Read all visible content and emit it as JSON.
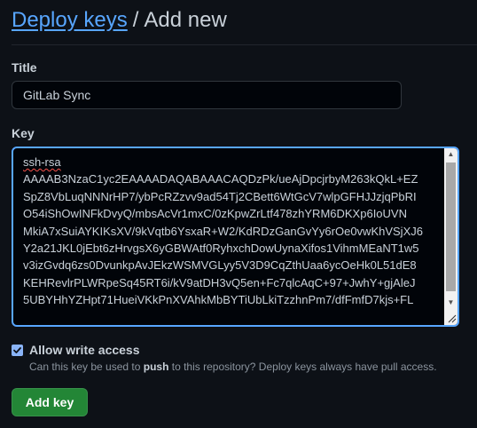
{
  "header": {
    "breadcrumb_link": "Deploy keys",
    "separator": "/",
    "current": "Add new"
  },
  "form": {
    "title_label": "Title",
    "title_value": "GitLab Sync",
    "key_label": "Key",
    "key_lines": [
      "ssh-rsa",
      "AAAAB3NzaC1yc2EAAAADAQABAAACAQDzPk/ueAjDpcjrbyM263kQkL+EZ",
      "SpZ8VbLuqNNNrHP7/ybPcRZzvv9ad54Tj2CBett6WtGcV7wlpGFHJJzjqPbRI",
      "O54iShOwINFkDvyQ/mbsAcVr1mxC/0zKpwZrLtf478zhYRM6DKXp6IoUVN",
      "MkiA7xSuiAYKIKsXV/9kVqtb6YsxaR+W2/KdRDzGanGvYy6rOe0vwKhVSjXJ6",
      "Y2a21JKL0jEbt6zHrvgsX6yGBWAtf0RyhxchDowUynaXifos1VihmMEaNT1w5",
      "v3izGvdq6zs0DvunkpAvJEkzWSMVGLyy5V3D9CqZthUaa6ycOeHk0L51dE8",
      "KEHRevlrPLWRpeSq45RT6i/kV9atDH3vQ5en+Fc7qlcAqC+97+JwhY+gjAleJ",
      "5UBYHhYZHpt71HueiVKkPnXVAhkMbBYTiUbLkiTzzhnPm7/dfFmfD7kjs+FL"
    ],
    "allow_write_label": "Allow write access",
    "allow_write_checked": true,
    "help_prefix": "Can this key be used to ",
    "help_bold": "push",
    "help_suffix": " to this repository? Deploy keys always have pull access.",
    "submit_label": "Add key"
  },
  "colors": {
    "background": "#0d1117",
    "link": "#58a6ff",
    "focus_border": "#58a6ff",
    "primary_button": "#238636",
    "checkbox": "#8ab4f8"
  }
}
